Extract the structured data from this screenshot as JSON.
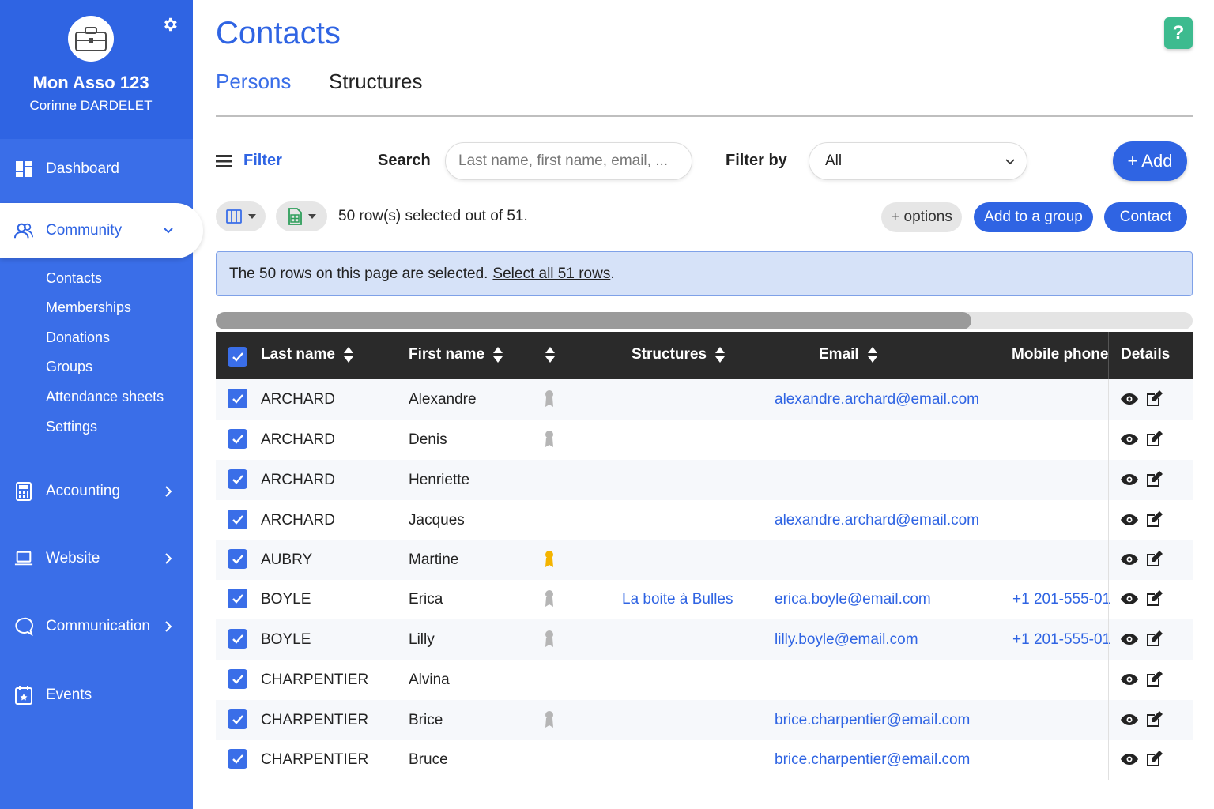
{
  "sidebar": {
    "org_name": "Mon Asso 123",
    "user_name": "Corinne DARDELET",
    "nav": [
      {
        "label": "Dashboard",
        "icon": "dashboard-icon"
      },
      {
        "label": "Community",
        "icon": "people-icon"
      },
      {
        "label": "Accounting",
        "icon": "calculator-icon"
      },
      {
        "label": "Website",
        "icon": "laptop-icon"
      },
      {
        "label": "Communication",
        "icon": "chat-icon"
      },
      {
        "label": "Events",
        "icon": "calendar-icon"
      }
    ],
    "community_sub": [
      "Contacts",
      "Memberships",
      "Donations",
      "Groups",
      "Attendance sheets",
      "Settings"
    ]
  },
  "header": {
    "title": "Contacts",
    "help": "?",
    "tabs": [
      "Persons",
      "Structures"
    ]
  },
  "toolbar": {
    "filter_label": "Filter",
    "search_label": "Search",
    "search_placeholder": "Last name, first name, email, ...",
    "filter_by_label": "Filter by",
    "filter_by_value": "All",
    "add_label": "+ Add",
    "selection_text": "50 row(s) selected out of 51.",
    "options_label": "+ options",
    "add_group_label": "Add to a group",
    "contact_label": "Contact"
  },
  "banner": {
    "text": "The 50 rows on this page are selected.",
    "link": "Select all 51 rows",
    "after": "."
  },
  "table": {
    "columns": [
      "Last name",
      "First name",
      "",
      "Structures",
      "Email",
      "Mobile phone",
      "Details"
    ],
    "rows": [
      {
        "last": "ARCHARD",
        "first": "Alexandre",
        "medal": "grey",
        "structure": "",
        "email": "alexandre.archard@email.com",
        "phone": ""
      },
      {
        "last": "ARCHARD",
        "first": "Denis",
        "medal": "grey",
        "structure": "",
        "email": "",
        "phone": ""
      },
      {
        "last": "ARCHARD",
        "first": "Henriette",
        "medal": "",
        "structure": "",
        "email": "",
        "phone": ""
      },
      {
        "last": "ARCHARD",
        "first": "Jacques",
        "medal": "",
        "structure": "",
        "email": "alexandre.archard@email.com",
        "phone": ""
      },
      {
        "last": "AUBRY",
        "first": "Martine",
        "medal": "gold",
        "structure": "",
        "email": "",
        "phone": ""
      },
      {
        "last": "BOYLE",
        "first": "Erica",
        "medal": "grey",
        "structure": "La boite à Bulles",
        "email": "erica.boyle@email.com",
        "phone": "+1 201-555-01"
      },
      {
        "last": "BOYLE",
        "first": "Lilly",
        "medal": "grey",
        "structure": "",
        "email": "lilly.boyle@email.com",
        "phone": "+1 201-555-01"
      },
      {
        "last": "CHARPENTIER",
        "first": "Alvina",
        "medal": "",
        "structure": "",
        "email": "",
        "phone": ""
      },
      {
        "last": "CHARPENTIER",
        "first": "Brice",
        "medal": "grey",
        "structure": "",
        "email": "brice.charpentier@email.com",
        "phone": ""
      },
      {
        "last": "CHARPENTIER",
        "first": "Bruce",
        "medal": "",
        "structure": "",
        "email": "brice.charpentier@email.com",
        "phone": ""
      }
    ]
  },
  "colors": {
    "sidebar": "#3a6ee8",
    "accent": "#2f64e3",
    "header_dark": "#2a2a2a",
    "help": "#3dbb8f",
    "medal_gold": "#f4b400",
    "medal_grey": "#b5b5b5"
  }
}
